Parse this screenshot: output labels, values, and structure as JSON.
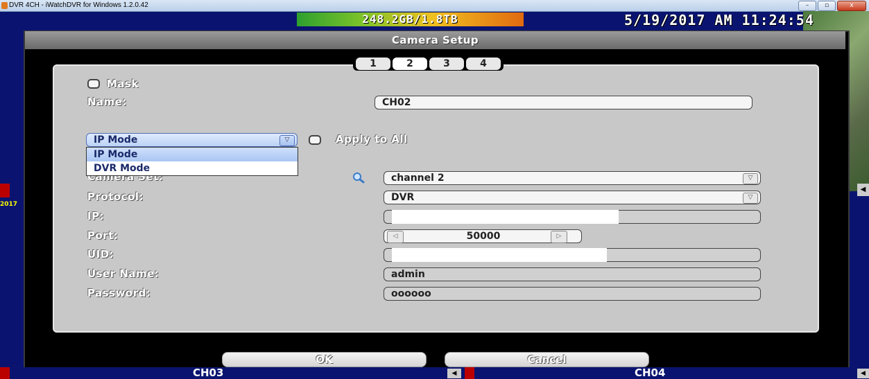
{
  "window": {
    "title": "DVR 4CH - iWatchDVR for Windows 1.2.0.42",
    "buttons": {
      "minimize": "–",
      "maximize": "▫",
      "close": "x"
    }
  },
  "overlay": {
    "storage": "248.2GB/1.8TB",
    "datetime": "5/19/2017 AM 11:24:54",
    "left_year": "2017",
    "ch03": "CH03",
    "ch04": "CH04"
  },
  "dialog": {
    "title": "Camera Setup",
    "tabs": [
      "1",
      "2",
      "3",
      "4"
    ],
    "selected_tab": "2",
    "mask_label": "Mask",
    "name_label": "Name:",
    "name_value": "CH02",
    "mode_value": "IP Mode",
    "mode_options": [
      "IP Mode",
      "DVR Mode"
    ],
    "apply_all_label": "Apply to All",
    "camera_set_label": "Camera Set:",
    "camera_set_value": "channel 2",
    "protocol_label": "Protocol:",
    "protocol_value": "DVR",
    "ip_label": "IP:",
    "port_label": "Port:",
    "port_value": "50000",
    "uid_label": "UID:",
    "username_label": "User Name:",
    "username_value": "admin",
    "password_label": "Password:",
    "password_value": "oooooo",
    "ok_label": "OK",
    "cancel_label": "Cancel"
  },
  "colors": {
    "panel": "#c8c8c8",
    "dialog_bg": "#000000",
    "desktop": "#0a1470"
  }
}
